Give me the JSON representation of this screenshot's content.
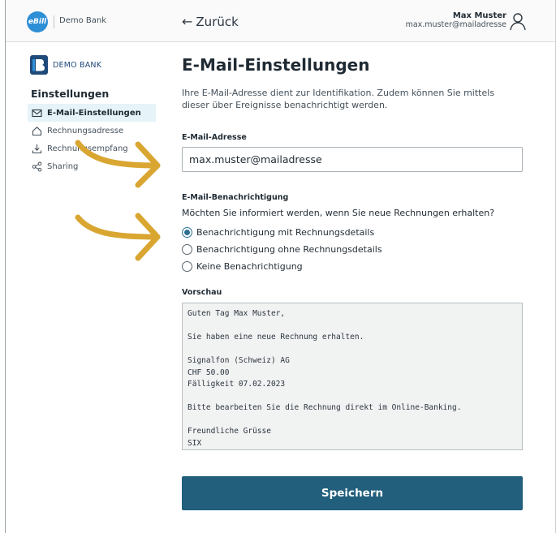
{
  "header": {
    "app_logo": "eBill",
    "bank_name": "Demo Bank",
    "back_label": "Zurück",
    "user_name": "Max Muster",
    "user_email": "max.muster@mailadresse"
  },
  "sidebar": {
    "logo_text": "DEMO BANK",
    "heading": "Einstellungen",
    "items": [
      {
        "label": "E-Mail-Einstellungen",
        "icon": "envelope-icon",
        "active": true
      },
      {
        "label": "Rechnungsadresse",
        "icon": "house-icon",
        "active": false
      },
      {
        "label": "Rechnungsempfang",
        "icon": "download-tray-icon",
        "active": false
      },
      {
        "label": "Sharing",
        "icon": "share-icon",
        "active": false
      }
    ]
  },
  "main": {
    "title": "E-Mail-Einstellungen",
    "intro": "Ihre E-Mail-Adresse dient zur Identifikation. Zudem können Sie mittels dieser über Ereignisse benachrichtigt werden.",
    "email_label": "E-Mail-Adresse",
    "email_value": "max.muster@mailadresse",
    "notification_label": "E-Mail-Benachrichtigung",
    "notification_question": "Möchten Sie informiert werden, wenn Sie neue Rechnungen erhalten?",
    "options": [
      {
        "label": "Benachrichtigung mit Rechnungsdetails",
        "checked": true
      },
      {
        "label": "Benachrichtigung ohne Rechnungsdetails",
        "checked": false
      },
      {
        "label": "Keine Benachrichtigung",
        "checked": false
      }
    ],
    "preview_label": "Vorschau",
    "preview_text": "Guten Tag Max Muster,\n\nSie haben eine neue Rechnung erhalten.\n\nSignalfon (Schweiz) AG\nCHF 50.00\nFälligkeit 07.02.2023\n\nBitte bearbeiten Sie die Rechnung direkt im Online-Banking.\n\nFreundliche Grüsse\nSIX",
    "save_label": "Speichern"
  },
  "colors": {
    "primary": "#215f7d",
    "active_bg": "#e6f3f8",
    "annotation_arrow": "#d9a632",
    "ebill_blue": "#2d8fd6"
  }
}
